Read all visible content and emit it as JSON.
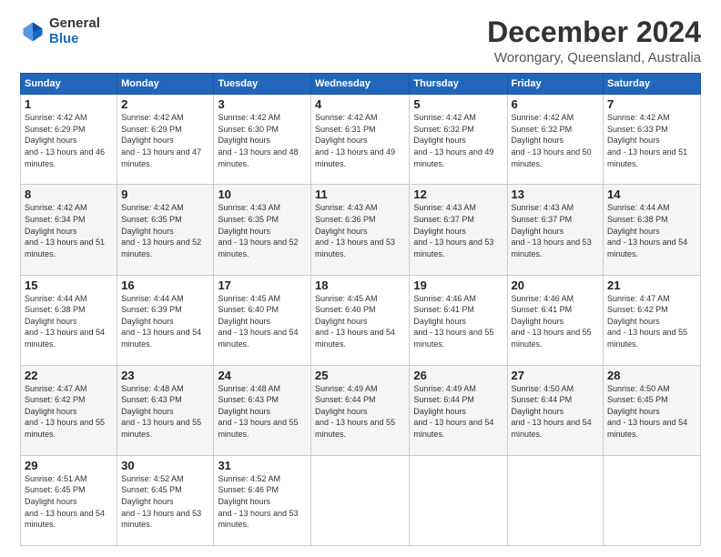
{
  "logo": {
    "general": "General",
    "blue": "Blue"
  },
  "title": "December 2024",
  "subtitle": "Worongary, Queensland, Australia",
  "days_header": [
    "Sunday",
    "Monday",
    "Tuesday",
    "Wednesday",
    "Thursday",
    "Friday",
    "Saturday"
  ],
  "weeks": [
    [
      {
        "day": "1",
        "sunrise": "4:42 AM",
        "sunset": "6:29 PM",
        "daylight": "13 hours and 46 minutes."
      },
      {
        "day": "2",
        "sunrise": "4:42 AM",
        "sunset": "6:29 PM",
        "daylight": "13 hours and 47 minutes."
      },
      {
        "day": "3",
        "sunrise": "4:42 AM",
        "sunset": "6:30 PM",
        "daylight": "13 hours and 48 minutes."
      },
      {
        "day": "4",
        "sunrise": "4:42 AM",
        "sunset": "6:31 PM",
        "daylight": "13 hours and 49 minutes."
      },
      {
        "day": "5",
        "sunrise": "4:42 AM",
        "sunset": "6:32 PM",
        "daylight": "13 hours and 49 minutes."
      },
      {
        "day": "6",
        "sunrise": "4:42 AM",
        "sunset": "6:32 PM",
        "daylight": "13 hours and 50 minutes."
      },
      {
        "day": "7",
        "sunrise": "4:42 AM",
        "sunset": "6:33 PM",
        "daylight": "13 hours and 51 minutes."
      }
    ],
    [
      {
        "day": "8",
        "sunrise": "4:42 AM",
        "sunset": "6:34 PM",
        "daylight": "13 hours and 51 minutes."
      },
      {
        "day": "9",
        "sunrise": "4:42 AM",
        "sunset": "6:35 PM",
        "daylight": "13 hours and 52 minutes."
      },
      {
        "day": "10",
        "sunrise": "4:43 AM",
        "sunset": "6:35 PM",
        "daylight": "13 hours and 52 minutes."
      },
      {
        "day": "11",
        "sunrise": "4:43 AM",
        "sunset": "6:36 PM",
        "daylight": "13 hours and 53 minutes."
      },
      {
        "day": "12",
        "sunrise": "4:43 AM",
        "sunset": "6:37 PM",
        "daylight": "13 hours and 53 minutes."
      },
      {
        "day": "13",
        "sunrise": "4:43 AM",
        "sunset": "6:37 PM",
        "daylight": "13 hours and 53 minutes."
      },
      {
        "day": "14",
        "sunrise": "4:44 AM",
        "sunset": "6:38 PM",
        "daylight": "13 hours and 54 minutes."
      }
    ],
    [
      {
        "day": "15",
        "sunrise": "4:44 AM",
        "sunset": "6:38 PM",
        "daylight": "13 hours and 54 minutes."
      },
      {
        "day": "16",
        "sunrise": "4:44 AM",
        "sunset": "6:39 PM",
        "daylight": "13 hours and 54 minutes."
      },
      {
        "day": "17",
        "sunrise": "4:45 AM",
        "sunset": "6:40 PM",
        "daylight": "13 hours and 54 minutes."
      },
      {
        "day": "18",
        "sunrise": "4:45 AM",
        "sunset": "6:40 PM",
        "daylight": "13 hours and 54 minutes."
      },
      {
        "day": "19",
        "sunrise": "4:46 AM",
        "sunset": "6:41 PM",
        "daylight": "13 hours and 55 minutes."
      },
      {
        "day": "20",
        "sunrise": "4:46 AM",
        "sunset": "6:41 PM",
        "daylight": "13 hours and 55 minutes."
      },
      {
        "day": "21",
        "sunrise": "4:47 AM",
        "sunset": "6:42 PM",
        "daylight": "13 hours and 55 minutes."
      }
    ],
    [
      {
        "day": "22",
        "sunrise": "4:47 AM",
        "sunset": "6:42 PM",
        "daylight": "13 hours and 55 minutes."
      },
      {
        "day": "23",
        "sunrise": "4:48 AM",
        "sunset": "6:43 PM",
        "daylight": "13 hours and 55 minutes."
      },
      {
        "day": "24",
        "sunrise": "4:48 AM",
        "sunset": "6:43 PM",
        "daylight": "13 hours and 55 minutes."
      },
      {
        "day": "25",
        "sunrise": "4:49 AM",
        "sunset": "6:44 PM",
        "daylight": "13 hours and 55 minutes."
      },
      {
        "day": "26",
        "sunrise": "4:49 AM",
        "sunset": "6:44 PM",
        "daylight": "13 hours and 54 minutes."
      },
      {
        "day": "27",
        "sunrise": "4:50 AM",
        "sunset": "6:44 PM",
        "daylight": "13 hours and 54 minutes."
      },
      {
        "day": "28",
        "sunrise": "4:50 AM",
        "sunset": "6:45 PM",
        "daylight": "13 hours and 54 minutes."
      }
    ],
    [
      {
        "day": "29",
        "sunrise": "4:51 AM",
        "sunset": "6:45 PM",
        "daylight": "13 hours and 54 minutes."
      },
      {
        "day": "30",
        "sunrise": "4:52 AM",
        "sunset": "6:45 PM",
        "daylight": "13 hours and 53 minutes."
      },
      {
        "day": "31",
        "sunrise": "4:52 AM",
        "sunset": "6:46 PM",
        "daylight": "13 hours and 53 minutes."
      },
      null,
      null,
      null,
      null
    ]
  ]
}
